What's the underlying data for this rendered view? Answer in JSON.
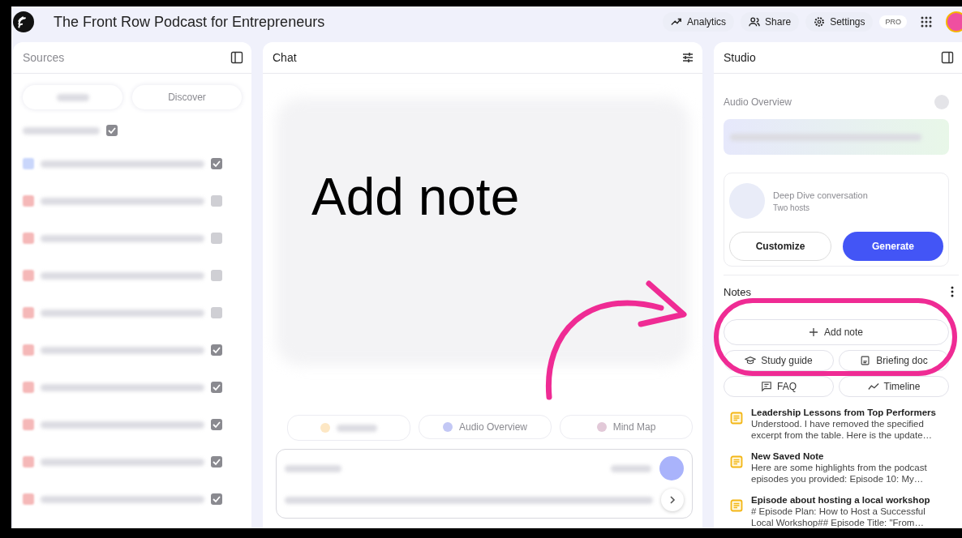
{
  "app_bar": {
    "title": "The Front Row Podcast for Entrepreneurs",
    "actions": [
      {
        "label": "Analytics",
        "kind": "analytics"
      },
      {
        "label": "Share",
        "kind": "share"
      },
      {
        "label": "Settings",
        "kind": "settings"
      }
    ],
    "badge": "PRO"
  },
  "sources": {
    "title": "Sources",
    "discover": "Discover",
    "select_all_checked": true,
    "items": [
      {
        "kind": "doc",
        "checked": true
      },
      {
        "kind": "pdf",
        "checked": false
      },
      {
        "kind": "pdf",
        "checked": false
      },
      {
        "kind": "pdf",
        "checked": false
      },
      {
        "kind": "pdf",
        "checked": false
      },
      {
        "kind": "pdf",
        "checked": true
      },
      {
        "kind": "pdf",
        "checked": true
      },
      {
        "kind": "pdf",
        "checked": true
      },
      {
        "kind": "pdf",
        "checked": true
      },
      {
        "kind": "pdf",
        "checked": true
      }
    ]
  },
  "chat": {
    "title": "Chat",
    "chips": [
      {
        "label": "Audio Overview",
        "kind": "audio"
      },
      {
        "label": "Mind Map",
        "kind": "mindmap"
      }
    ]
  },
  "studio": {
    "title": "Studio",
    "audio_title": "Audio Overview",
    "card_title": "Deep Dive conversation",
    "card_subtitle": "Two hosts",
    "customize": "Customize",
    "generate": "Generate",
    "notes_title": "Notes",
    "add_note": "Add note",
    "tools": [
      {
        "label": "Study guide",
        "kind": "study"
      },
      {
        "label": "Briefing doc",
        "kind": "briefing"
      },
      {
        "label": "FAQ",
        "kind": "faq"
      },
      {
        "label": "Timeline",
        "kind": "timeline"
      }
    ],
    "notes": [
      {
        "title": "Leadership Lessons from Top Performers",
        "preview": "Understood. I have removed the specified excerpt from the table. Here is the update…"
      },
      {
        "title": "New Saved Note",
        "preview": "Here are some highlights from the podcast episodes you provided: Episode 10: My…"
      },
      {
        "title": "Episode about hosting a local workshop",
        "preview": "# Episode Plan: How to Host a Successful Local Workshop## Episode Title: \"From…"
      }
    ]
  },
  "annotation": {
    "caption": "Add note"
  }
}
